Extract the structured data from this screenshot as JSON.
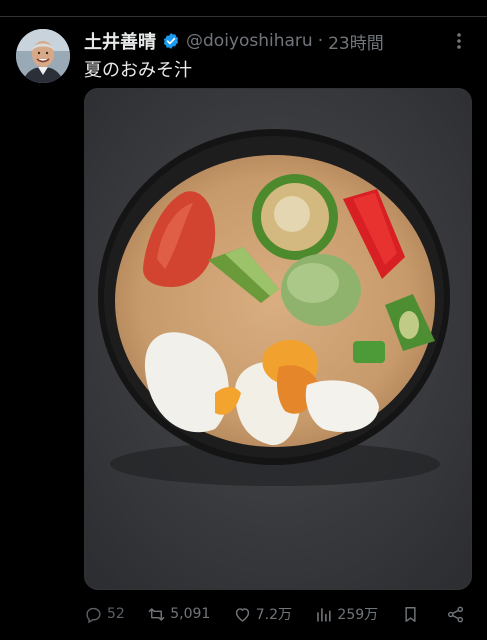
{
  "post": {
    "author_name": "土井善晴",
    "handle": "@doiyoshiharu",
    "separator": "·",
    "time": "23時間",
    "text": "夏のおみそ汁",
    "verified": true,
    "avatar": "author-photo",
    "image": "miso-soup-photo"
  },
  "icons": {
    "verified": "verified-badge-icon",
    "more": "more-dots-icon",
    "reply": "reply-icon",
    "repost": "repost-icon",
    "like": "like-icon",
    "views": "views-icon",
    "bookmark": "bookmark-icon",
    "share": "share-icon"
  },
  "actions": {
    "replies": "52",
    "reposts": "5,091",
    "likes": "7.2万",
    "views": "259万"
  },
  "colors": {
    "background": "#000000",
    "text": "#e7e9ea",
    "muted": "#71767b",
    "verified": "#1d9bf0"
  }
}
